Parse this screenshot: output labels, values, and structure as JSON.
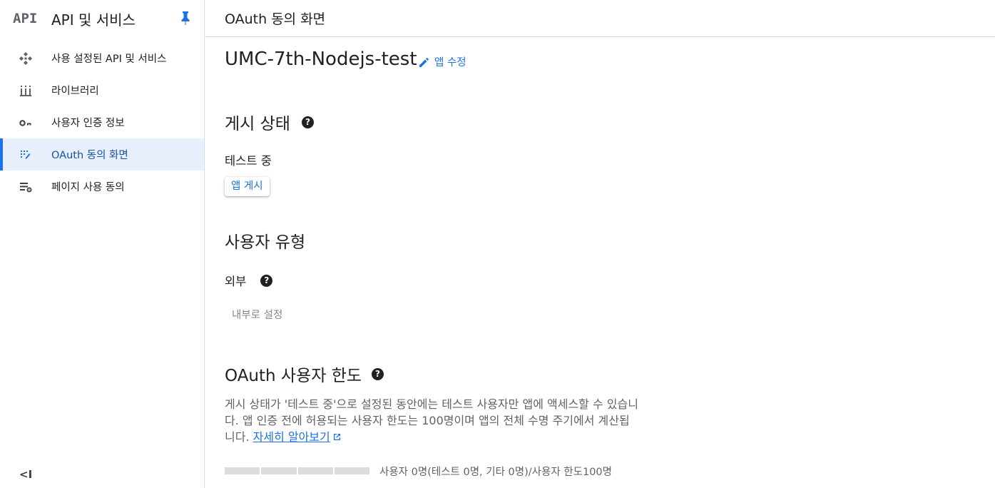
{
  "sidebar": {
    "logo": "API",
    "title": "API 및 서비스",
    "items": [
      {
        "label": "사용 설정된 API 및 서비스",
        "icon": "api-diamond-icon",
        "active": false
      },
      {
        "label": "라이브러리",
        "icon": "library-icon",
        "active": false
      },
      {
        "label": "사용자 인증 정보",
        "icon": "key-icon",
        "active": false
      },
      {
        "label": "OAuth 동의 화면",
        "icon": "oauth-consent-icon",
        "active": true
      },
      {
        "label": "페이지 사용 동의",
        "icon": "page-usage-settings-icon",
        "active": false
      }
    ],
    "collapse_label": "<I"
  },
  "topbar": {
    "title": "OAuth 동의 화면"
  },
  "main": {
    "app_name": "UMC-7th-Nodejs-test",
    "edit_label": "앱 수정",
    "publish_section": {
      "title": "게시 상태",
      "status": "테스트 중",
      "button": "앱 게시"
    },
    "user_type_section": {
      "title": "사용자 유형",
      "value": "외부",
      "button": "내부로 설정"
    },
    "user_limit_section": {
      "title": "OAuth 사용자 한도",
      "description": "게시 상태가 '테스트 중'으로 설정된 동안에는 테스트 사용자만 앱에 액세스할 수 있습니다. 앱 인증 전에 허용되는 사용자 한도는 100명이며 앱의 전체 수명 주기에서 계산됩니다.",
      "learn_more": "자세히 알아보기",
      "usage_text": "사용자 0명(테스트 0명, 기타 0명)/사용자 한도100명",
      "usage_fraction": 0
    }
  },
  "colors": {
    "accent": "#1a73e8",
    "active_bg": "#e8f0fe",
    "border": "#dadce0"
  }
}
